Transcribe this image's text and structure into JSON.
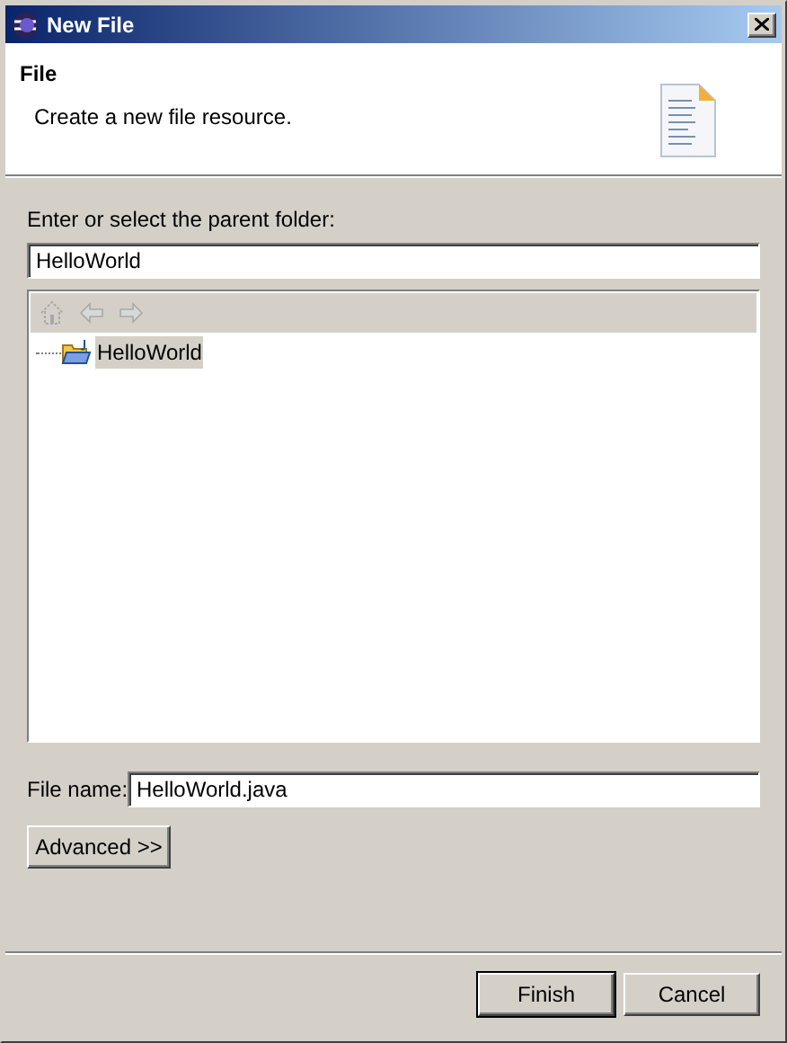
{
  "window": {
    "title": "New File"
  },
  "header": {
    "title": "File",
    "description": "Create a new file resource."
  },
  "parent_folder": {
    "label": "Enter or select the parent folder:",
    "value": "HelloWorld"
  },
  "tree_toolbar": [
    {
      "kind": "home",
      "disabled": true
    },
    {
      "kind": "back",
      "disabled": true
    },
    {
      "kind": "forward",
      "disabled": true
    }
  ],
  "tree": [
    {
      "label": "HelloWorld",
      "selected": true
    }
  ],
  "file_name": {
    "label": "File name:",
    "value": "HelloWorld.java"
  },
  "advanced_button": {
    "label": "Advanced >>"
  },
  "buttons": [
    {
      "label": "Finish",
      "default": true
    },
    {
      "label": "Cancel",
      "default": false
    }
  ]
}
